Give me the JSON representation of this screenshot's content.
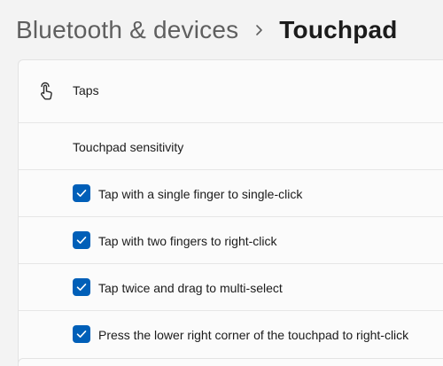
{
  "breadcrumb": {
    "parent": "Bluetooth & devices",
    "current": "Touchpad"
  },
  "taps": {
    "title": "Taps",
    "icon": "touch-tap-icon",
    "sensitivity_label": "Touchpad sensitivity",
    "options": [
      {
        "label": "Tap with a single finger to single-click",
        "checked": true
      },
      {
        "label": "Tap with two fingers to right-click",
        "checked": true
      },
      {
        "label": "Tap twice and drag to multi-select",
        "checked": true
      },
      {
        "label": "Press the lower right corner of the touchpad to right-click",
        "checked": true
      }
    ]
  },
  "colors": {
    "accent": "#005fb8",
    "background": "#f3f3f3",
    "card": "#fbfbfb"
  }
}
